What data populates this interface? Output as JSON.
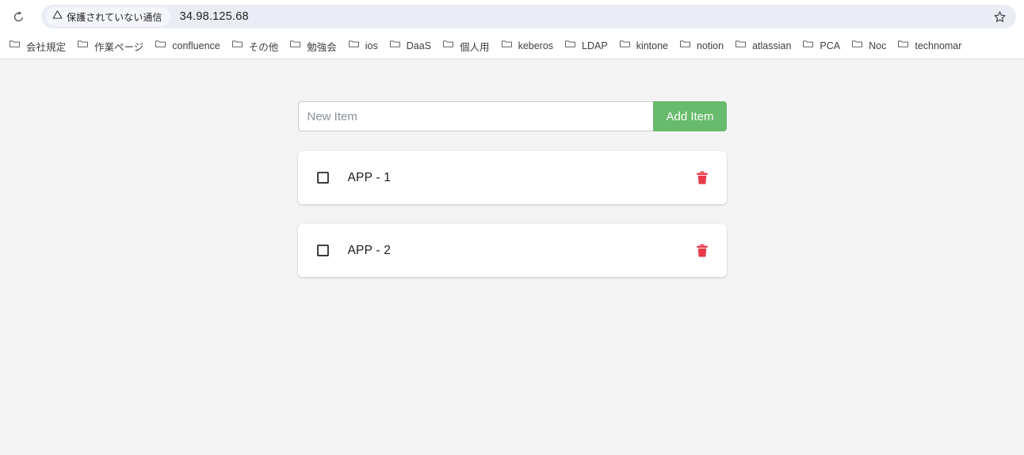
{
  "browser": {
    "reload_icon": "reload-icon",
    "star_icon": "bookmark-star-icon",
    "omnibox": {
      "security_icon": "not-secure-warning-icon",
      "security_label": "保護されていない通信",
      "url": "34.98.125.68"
    },
    "bookmarks": [
      {
        "icon": "folder-icon",
        "label": "会社規定"
      },
      {
        "icon": "folder-icon",
        "label": "作業ページ"
      },
      {
        "icon": "folder-icon",
        "label": "confluence"
      },
      {
        "icon": "folder-icon",
        "label": "その他"
      },
      {
        "icon": "folder-icon",
        "label": "勉強会"
      },
      {
        "icon": "folder-icon",
        "label": "ios"
      },
      {
        "icon": "folder-icon",
        "label": "DaaS"
      },
      {
        "icon": "folder-icon",
        "label": "個人用"
      },
      {
        "icon": "folder-icon",
        "label": "keberos"
      },
      {
        "icon": "folder-icon",
        "label": "LDAP"
      },
      {
        "icon": "folder-icon",
        "label": "kintone"
      },
      {
        "icon": "folder-icon",
        "label": "notion"
      },
      {
        "icon": "folder-icon",
        "label": "atlassian"
      },
      {
        "icon": "folder-icon",
        "label": "PCA"
      },
      {
        "icon": "folder-icon",
        "label": "Noc"
      },
      {
        "icon": "folder-icon",
        "label": "technomar"
      }
    ]
  },
  "app": {
    "form": {
      "input_value": "",
      "input_placeholder": "New Item",
      "add_button_label": "Add Item",
      "add_button_color": "#68bb6c"
    },
    "items": [
      {
        "label": "APP - 1",
        "checked": false,
        "checkbox_icon": "unchecked-checkbox-icon",
        "delete_icon": "trash-icon",
        "delete_icon_color": "#e8394a"
      },
      {
        "label": "APP - 2",
        "checked": false,
        "checkbox_icon": "unchecked-checkbox-icon",
        "delete_icon": "trash-icon",
        "delete_icon_color": "#e8394a"
      }
    ]
  }
}
